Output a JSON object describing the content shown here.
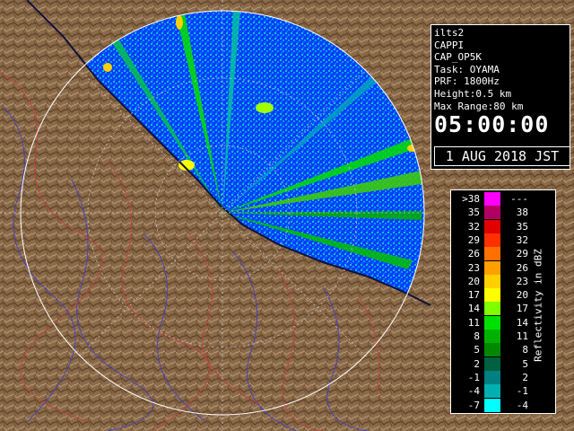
{
  "info": {
    "lines": [
      "ilts2",
      "CAPPI",
      "CAP_OP5K",
      "Task: OYAMA",
      "PRF: 1800Hz",
      "Height:0.5 km",
      "Max Range:80 km"
    ],
    "time": "05:00:00",
    "date": "1 AUG 2018 JST"
  },
  "legend": {
    "title": "Reflectivity in dBZ",
    "rows": [
      {
        "low": ">38",
        "high": "---",
        "color": "#ff00ff"
      },
      {
        "low": "35",
        "high": "38",
        "color": "#b00060"
      },
      {
        "low": "32",
        "high": "35",
        "color": "#e00000"
      },
      {
        "low": "29",
        "high": "32",
        "color": "#ff3000"
      },
      {
        "low": "26",
        "high": "29",
        "color": "#ff7000"
      },
      {
        "low": "23",
        "high": "26",
        "color": "#ffa000"
      },
      {
        "low": "20",
        "high": "23",
        "color": "#ffd000"
      },
      {
        "low": "17",
        "high": "20",
        "color": "#ffff00"
      },
      {
        "low": "14",
        "high": "17",
        "color": "#80ff00"
      },
      {
        "low": "11",
        "high": "14",
        "color": "#00e000"
      },
      {
        "low": "8",
        "high": "11",
        "color": "#00b000"
      },
      {
        "low": "5",
        "high": "8",
        "color": "#008800"
      },
      {
        "low": "2",
        "high": "5",
        "color": "#006040"
      },
      {
        "low": "-1",
        "high": "2",
        "color": "#008080"
      },
      {
        "low": "-4",
        "high": "-1",
        "color": "#00b0b0"
      },
      {
        "low": "-7",
        "high": "-4",
        "color": "#00ffff"
      }
    ]
  },
  "colors": {
    "sea": "#0a3cff",
    "land": "#8a6a48",
    "rivers": "#4040c0",
    "boundaries": "#c04040"
  }
}
